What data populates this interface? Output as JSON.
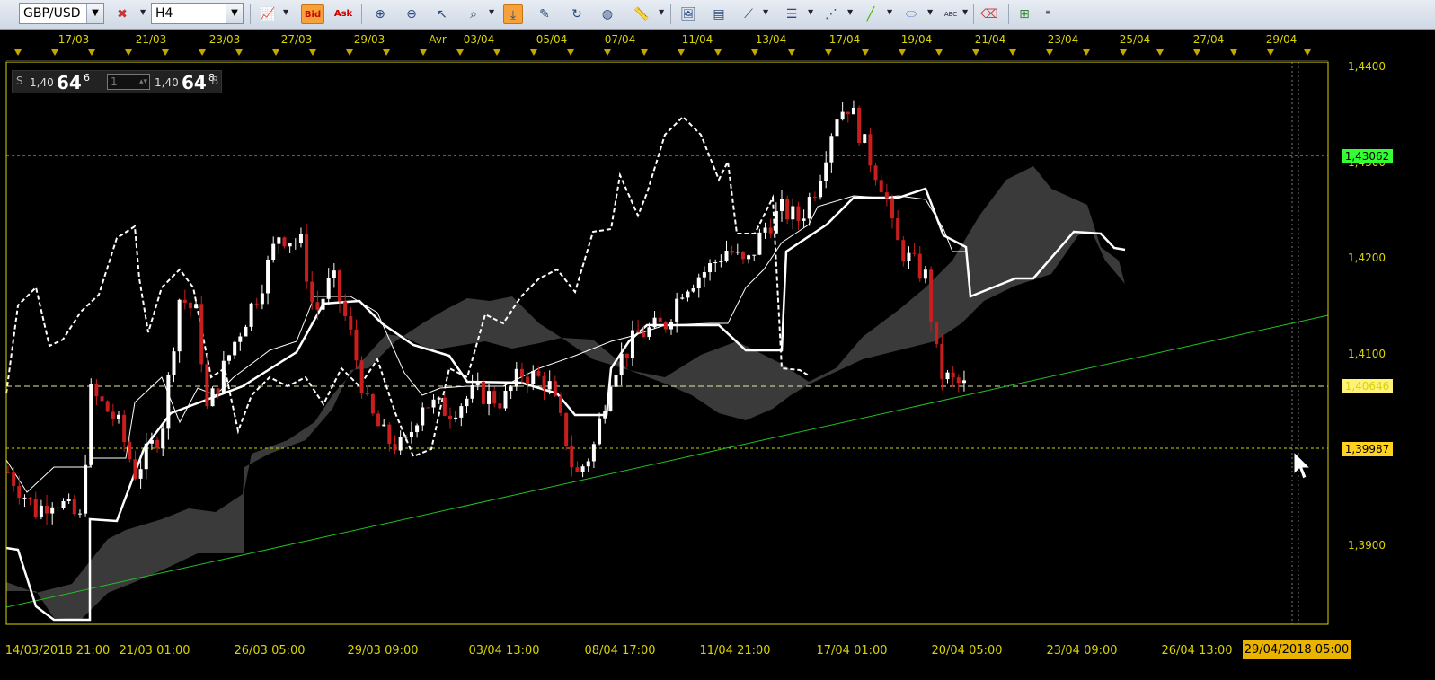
{
  "toolbar": {
    "symbol": "GBP/USD",
    "timeframe": "H4",
    "bid_label": "Bid",
    "ask_label": "Ask",
    "text_tool_label": "ABC"
  },
  "quote": {
    "sell_label": "S",
    "sell_prefix": "1,40",
    "sell_big": "64",
    "sell_sup": "6",
    "lot_value": "1",
    "buy_prefix": "1,40",
    "buy_big": "64",
    "buy_sup": "8",
    "buy_label": "B"
  },
  "top_dates": [
    "17/03",
    "21/03",
    "23/03",
    "27/03",
    "29/03",
    "Avr",
    "03/04",
    "05/04",
    "07/04",
    "11/04",
    "13/04",
    "17/04",
    "19/04",
    "21/04",
    "23/04",
    "25/04",
    "27/04",
    "29/04"
  ],
  "bottom_dates": [
    "14/03/2018 21:00",
    "21/03 01:00",
    "26/03 05:00",
    "29/03 09:00",
    "03/04 13:00",
    "08/04 17:00",
    "11/04 21:00",
    "17/04 01:00",
    "20/04 05:00",
    "23/04 09:00",
    "26/04 13:00"
  ],
  "bottom_highlight": "29/04/2018 05:00",
  "price_axis": [
    "1,4400",
    "1,4300",
    "1,4200",
    "1,4100",
    "1,4000",
    "1,3900"
  ],
  "price_levels": {
    "upper": "1,43062",
    "current": "1,40646",
    "lower": "1,39987"
  },
  "colors": {
    "axis_text": "#d9d400",
    "frame": "#d9d400",
    "bull_candle": "#ffffff",
    "bear_candle": "#c81e1e",
    "cloud": "#3a3a3a",
    "trendline": "#22c022",
    "upper_badge": "#33ff33",
    "current_badge": "#fff27a",
    "lower_badge": "#ffd21f"
  }
}
